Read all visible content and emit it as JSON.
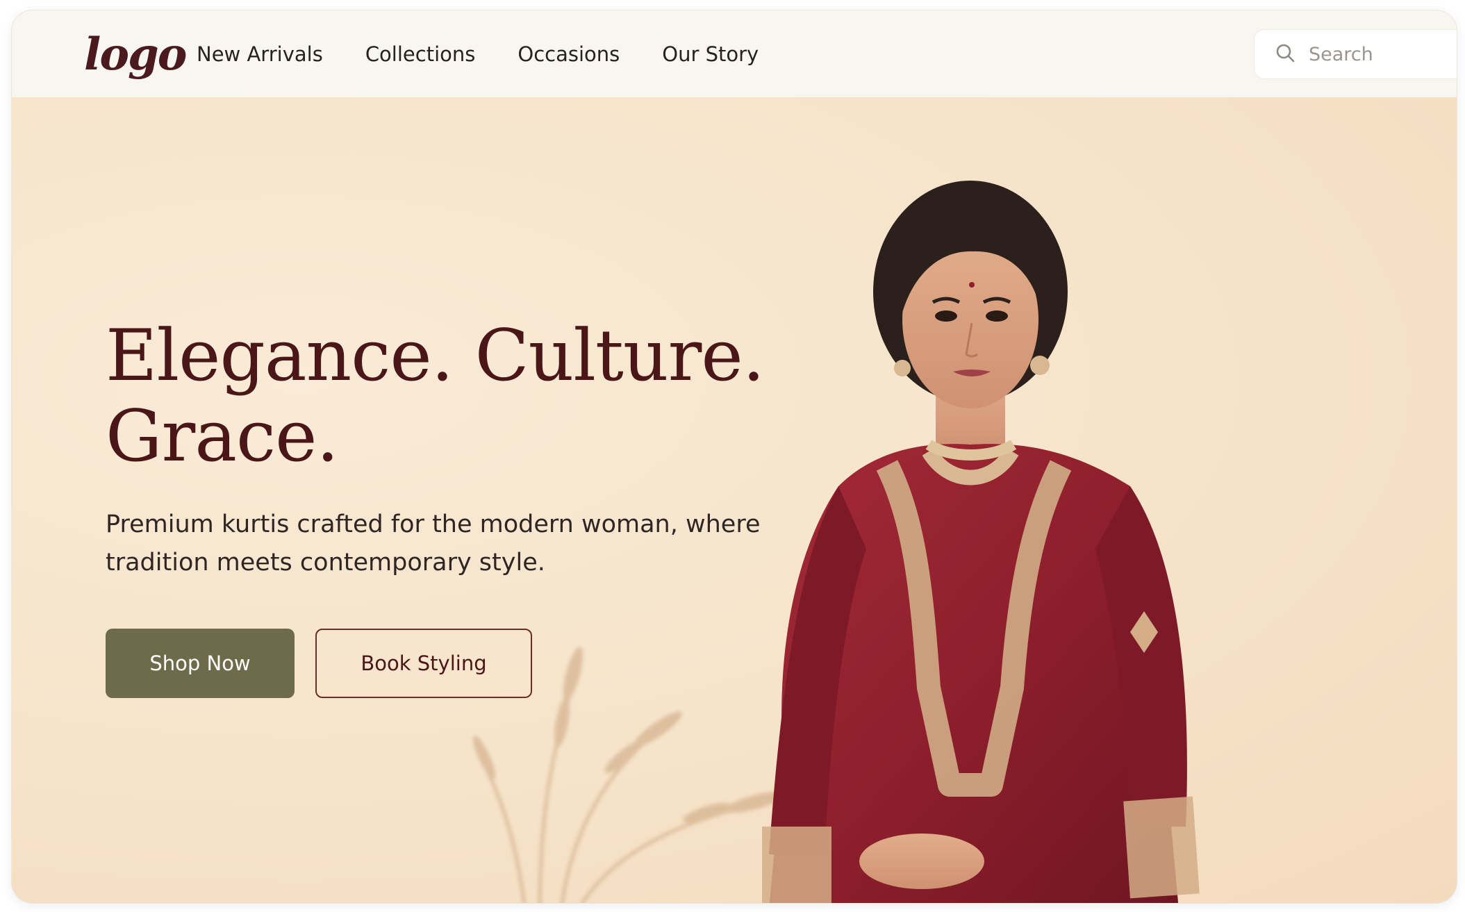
{
  "brand": {
    "logo_text": "logo"
  },
  "nav": {
    "links": [
      {
        "label": "New Arrivals"
      },
      {
        "label": "Collections"
      },
      {
        "label": "Occasions"
      },
      {
        "label": "Our Story"
      }
    ]
  },
  "search": {
    "placeholder": "Search",
    "icon": "search-icon"
  },
  "hero": {
    "headline_line1": "Elegance. Culture.",
    "headline_line2": "Grace.",
    "subtitle_line1": "Premium kurtis crafted for the modern woman, where",
    "subtitle_line2": "tradition meets contemporary style.",
    "primary_button": "Shop Now",
    "secondary_button": "Book Styling"
  },
  "colors": {
    "background": "#f6e4cb",
    "nav_background": "#f8f6f1",
    "headline": "#4a1618",
    "primary_button": "#6e6b4a",
    "kurta": "#8e1f2c",
    "embroidery": "#d2ad86"
  }
}
